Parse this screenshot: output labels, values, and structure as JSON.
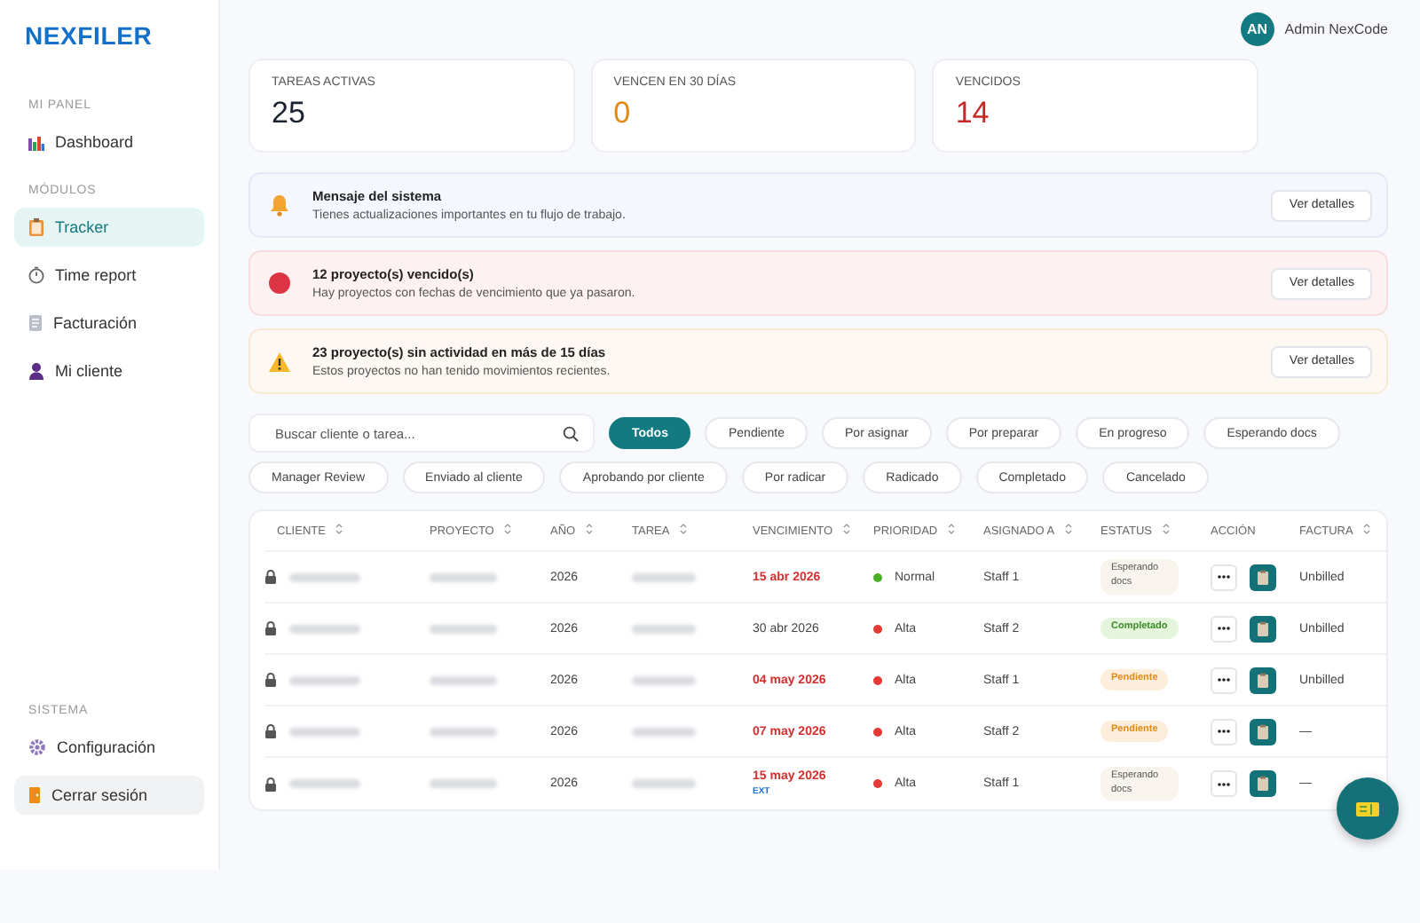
{
  "brand": "NEXFILER",
  "user": {
    "initials": "AN",
    "name": "Admin NexCode"
  },
  "sidebar": {
    "sections": [
      {
        "title": "MI PANEL",
        "items": [
          {
            "label": "Dashboard",
            "kind": "chart",
            "selected": false
          }
        ]
      },
      {
        "title": "MÓDULOS",
        "items": [
          {
            "label": "Tracker",
            "kind": "clipboard",
            "selected": true
          },
          {
            "label": "Time report",
            "kind": "timer",
            "selected": false
          },
          {
            "label": "Facturación",
            "kind": "document",
            "selected": false
          },
          {
            "label": "Mi cliente",
            "kind": "person",
            "selected": false
          }
        ]
      },
      {
        "title": "SISTEMA",
        "items": [
          {
            "label": "Configuración",
            "kind": "gear",
            "selected": false
          },
          {
            "label": "Cerrar sesión",
            "kind": "logout",
            "selected": false
          }
        ]
      }
    ]
  },
  "stats": [
    {
      "label": "TAREAS ACTIVAS",
      "value": "25",
      "kind": "neutral"
    },
    {
      "label": "VENCEN EN 30 DÍAS",
      "value": "0",
      "kind": "warning"
    },
    {
      "label": "VENCIDOS",
      "value": "14",
      "kind": "danger"
    }
  ],
  "alerts": [
    {
      "kind": "info",
      "title": "Mensaje del sistema",
      "message": "Tienes actualizaciones importantes en tu flujo de trabajo.",
      "button": "Ver detalles"
    },
    {
      "kind": "danger",
      "title": "12 proyecto(s) vencido(s)",
      "message": "Hay proyectos con fechas de vencimiento que ya pasaron.",
      "button": "Ver detalles"
    },
    {
      "kind": "warning",
      "title": "23 proyecto(s) sin actividad en más de 15 días",
      "message": "Estos proyectos no han tenido movimientos recientes.",
      "button": "Ver detalles"
    }
  ],
  "search": {
    "placeholder": "Buscar cliente o tarea..."
  },
  "filters": [
    {
      "label": "Todos",
      "selected": true
    },
    {
      "label": "Pendiente",
      "selected": false
    },
    {
      "label": "Por asignar",
      "selected": false
    },
    {
      "label": "Por preparar",
      "selected": false
    },
    {
      "label": "En progreso",
      "selected": false
    },
    {
      "label": "Esperando docs",
      "selected": false
    },
    {
      "label": "Manager Review",
      "selected": false
    },
    {
      "label": "Enviado al cliente",
      "selected": false
    },
    {
      "label": "Aprobando por cliente",
      "selected": false
    },
    {
      "label": "Por radicar",
      "selected": false
    },
    {
      "label": "Radicado",
      "selected": false
    },
    {
      "label": "Completado",
      "selected": false
    },
    {
      "label": "Cancelado",
      "selected": false
    }
  ],
  "table": {
    "columns": [
      {
        "label": "CLIENTE",
        "sortable": true
      },
      {
        "label": "PROYECTO",
        "sortable": true
      },
      {
        "label": "AÑO",
        "sortable": true
      },
      {
        "label": "TAREA",
        "sortable": true
      },
      {
        "label": "VENCIMIENTO",
        "sortable": true
      },
      {
        "label": "PRIORIDAD",
        "sortable": true
      },
      {
        "label": "ASIGNADO A",
        "sortable": true
      },
      {
        "label": "ESTATUS",
        "sortable": true
      },
      {
        "label": "ACCIÓN",
        "sortable": false
      },
      {
        "label": "FACTURA",
        "sortable": true
      }
    ],
    "rows": [
      {
        "year": "2026",
        "due": "15 abr 2026",
        "overdue": true,
        "priority": {
          "label": "Normal",
          "color": "#4caf28"
        },
        "assignee": "Staff 1",
        "status": {
          "label": "Esperando docs",
          "kind": "waiting"
        },
        "invoice": "Unbilled"
      },
      {
        "year": "2026",
        "due": "30 abr 2026",
        "overdue": false,
        "priority": {
          "label": "Alta",
          "color": "#e53935"
        },
        "assignee": "Staff 2",
        "status": {
          "label": "Completado",
          "kind": "done"
        },
        "invoice": "Unbilled"
      },
      {
        "year": "2026",
        "due": "04 may 2026",
        "overdue": true,
        "priority": {
          "label": "Alta",
          "color": "#e53935"
        },
        "assignee": "Staff 1",
        "status": {
          "label": "Pendiente",
          "kind": "pending"
        },
        "invoice": "Unbilled"
      },
      {
        "year": "2026",
        "due": "07 may 2026",
        "overdue": true,
        "priority": {
          "label": "Alta",
          "color": "#e53935"
        },
        "assignee": "Staff 2",
        "status": {
          "label": "Pendiente",
          "kind": "pending"
        },
        "invoice": "—"
      },
      {
        "year": "2026",
        "due": "15 may 2026",
        "overdue": true,
        "tag": "EXT",
        "priority": {
          "label": "Alta",
          "color": "#e53935"
        },
        "assignee": "Staff 1",
        "status": {
          "label": "Esperando docs",
          "kind": "waiting"
        },
        "invoice": "—"
      }
    ]
  }
}
